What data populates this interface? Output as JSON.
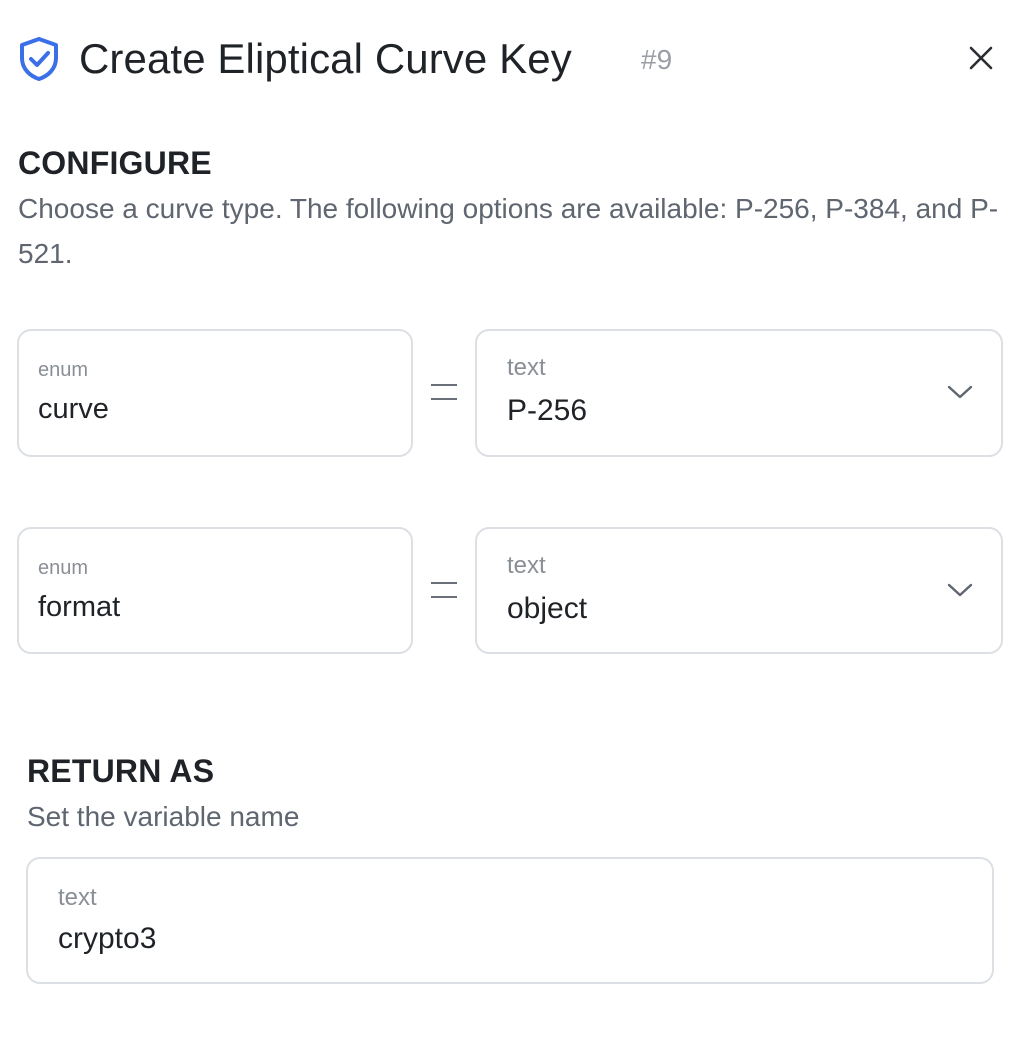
{
  "header": {
    "title": "Create Eliptical Curve Key",
    "step_badge": "#9",
    "icon": "shield-check-icon",
    "close_icon": "close-icon",
    "accent_color": "#3a6fe8"
  },
  "configure": {
    "title": "CONFIGURE",
    "description": "Choose a curve type. The following options are available: P-256, P-384, and P-521.",
    "params": [
      {
        "name_type": "enum",
        "name": "curve",
        "operator": "=",
        "value_type": "text",
        "value": "P-256"
      },
      {
        "name_type": "enum",
        "name": "format",
        "operator": "=",
        "value_type": "text",
        "value": "object"
      }
    ]
  },
  "return_as": {
    "title": "RETURN AS",
    "description": "Set the variable name",
    "value_type": "text",
    "value": "crypto3"
  }
}
